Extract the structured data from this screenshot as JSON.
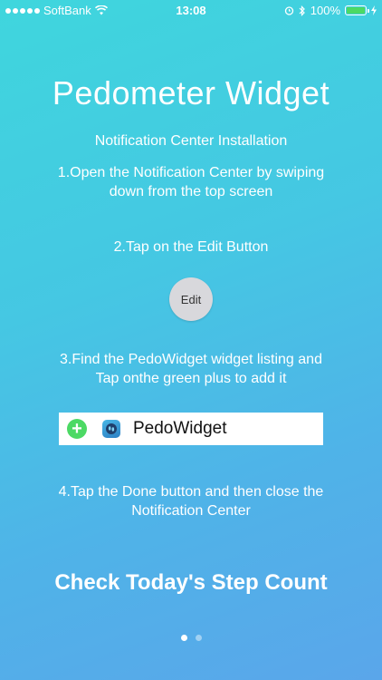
{
  "status_bar": {
    "carrier": "SoftBank",
    "time": "13:08",
    "battery": "100%"
  },
  "title": "Pedometer Widget",
  "subtitle": "Notification Center Installation",
  "steps": {
    "s1_line1": "1.Open the Notification Center by swiping",
    "s1_line2": "down from the top screen",
    "s2": "2.Tap on the Edit Button",
    "s3_line1": "3.Find the PedoWidget widget listing and",
    "s3_line2": "Tap onthe green plus to add it",
    "s4_line1": "4.Tap the Done button and then close the",
    "s4_line2": "Notification Center"
  },
  "edit_button_label": "Edit",
  "widget_row": {
    "plus_glyph": "+",
    "label": "PedoWidget"
  },
  "cta": "Check Today's Step Count",
  "pager": {
    "pages": 2,
    "current": 1
  },
  "colors": {
    "accent_green": "#4cd964",
    "background_top": "#3fd6dd",
    "background_bottom": "#5aa6ea"
  }
}
